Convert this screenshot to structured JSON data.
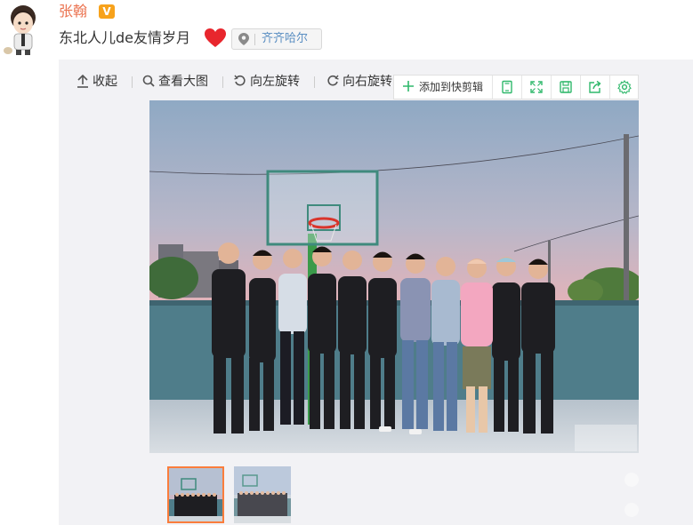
{
  "post": {
    "author": "张翰",
    "verified_badge": "V",
    "text": "东北人儿de友情岁月",
    "location": "齐齐哈尔"
  },
  "toolbar": {
    "collapse_label": "收起",
    "view_large_label": "查看大图",
    "rotate_left_label": "向左旋转",
    "rotate_right_label": "向右旋转"
  },
  "float_bar": {
    "add_to_clip_label": "添加到快剪辑",
    "icons": [
      "clip-doc-icon",
      "expand-icon",
      "save-icon",
      "share-icon",
      "settings-icon"
    ]
  },
  "thumbnails": [
    {
      "name": "photo-1",
      "selected": true
    },
    {
      "name": "photo-2",
      "selected": false
    }
  ],
  "colors": {
    "username": "#eb7350",
    "location_text": "#5a8ec2",
    "badge": "#f7a21b",
    "accent_green": "#2fb86b",
    "thumb_selected_border": "#fa7d3c",
    "panel_bg": "#f2f2f5"
  }
}
